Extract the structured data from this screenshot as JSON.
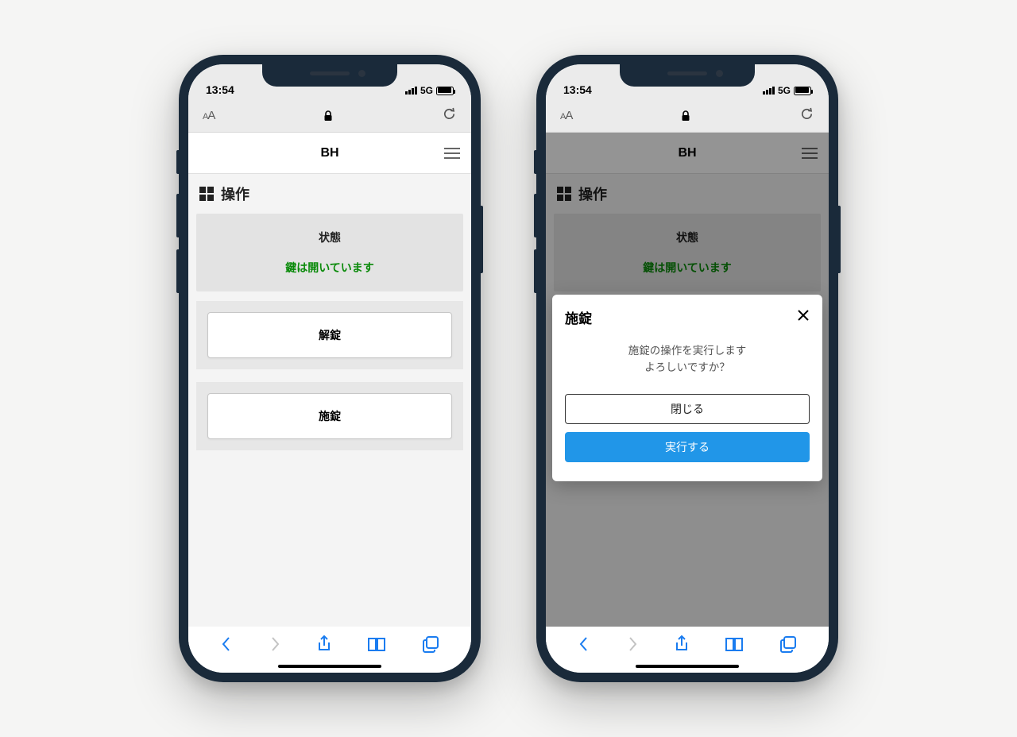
{
  "status": {
    "time": "13:54",
    "net": "5G"
  },
  "app": {
    "title": "BH",
    "section": "操作"
  },
  "card": {
    "label": "状態",
    "status": "鍵は開いています"
  },
  "actions": {
    "unlock": "解錠",
    "lock": "施錠"
  },
  "modal": {
    "title": "施錠",
    "line1": "施錠の操作を実行します",
    "line2": "よろしいですか？",
    "close": "閉じる",
    "confirm": "実行する"
  }
}
